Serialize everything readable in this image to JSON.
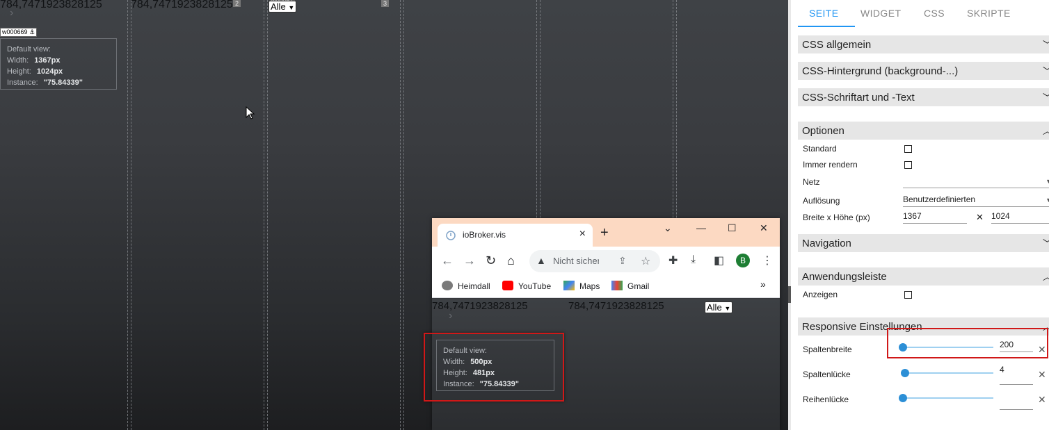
{
  "canvas": {
    "value_top_1": "784,7471923828125",
    "value_top_2": "784,7471923828125",
    "alle_label": "Alle",
    "widget_id": "w000669",
    "widget_id_2": "w00067",
    "badge_2": "2",
    "badge_3": "3",
    "info": {
      "title": "Default view:",
      "width_label": "Width:",
      "width_value": "1367px",
      "height_label": "Height:",
      "height_value": "1024px",
      "instance_label": "Instance:",
      "instance_value": "\"75.84339\""
    }
  },
  "browser": {
    "tab_title": "ioBroker.vis",
    "url_text": "Nicht sicher",
    "profile_initial": "B",
    "bookmarks": [
      {
        "label": "Heimdall",
        "icon": "heimdall-icon",
        "color": "#7a7a7a"
      },
      {
        "label": "YouTube",
        "icon": "youtube-icon",
        "color": "#ff0000"
      },
      {
        "label": "Maps",
        "icon": "maps-icon",
        "color": "#34a853"
      },
      {
        "label": "Gmail",
        "icon": "gmail-icon",
        "color": "#ea4335"
      }
    ],
    "content": {
      "value_1": "784,7471923828125",
      "value_2": "784,7471923828125",
      "alle_label": "Alle",
      "info": {
        "title": "Default view:",
        "width_label": "Width:",
        "width_value": "500px",
        "height_label": "Height:",
        "height_value": "481px",
        "instance_label": "Instance:",
        "instance_value": "\"75.84339\""
      }
    }
  },
  "panel": {
    "tabs": [
      "SEITE",
      "WIDGET",
      "CSS",
      "SKRIPTE"
    ],
    "active_tab": "SEITE",
    "accent_color": "#2196f3",
    "sections": {
      "css_general": "CSS allgemein",
      "css_background": "CSS-Hintergrund (background-...)",
      "css_font": "CSS-Schriftart und -Text",
      "options": "Optionen",
      "navigation": "Navigation",
      "app_bar": "Anwendungsleiste",
      "responsive": "Responsive Einstellungen"
    },
    "options": {
      "standard_label": "Standard",
      "always_render_label": "Immer rendern",
      "grid_label": "Netz",
      "grid_value": "",
      "resolution_label": "Auflösung",
      "resolution_value": "Benutzerdefinierten",
      "size_label": "Breite x Höhe (px)",
      "width_value": "1367",
      "height_value": "1024",
      "times": "✕"
    },
    "app_bar": {
      "show_label": "Anzeigen"
    },
    "responsive": {
      "column_width_label": "Spaltenbreite",
      "column_width_value": "200",
      "column_gap_label": "Spaltenlücke",
      "column_gap_value": "4",
      "row_gap_label": "Reihenlücke",
      "row_gap_value": ""
    }
  }
}
